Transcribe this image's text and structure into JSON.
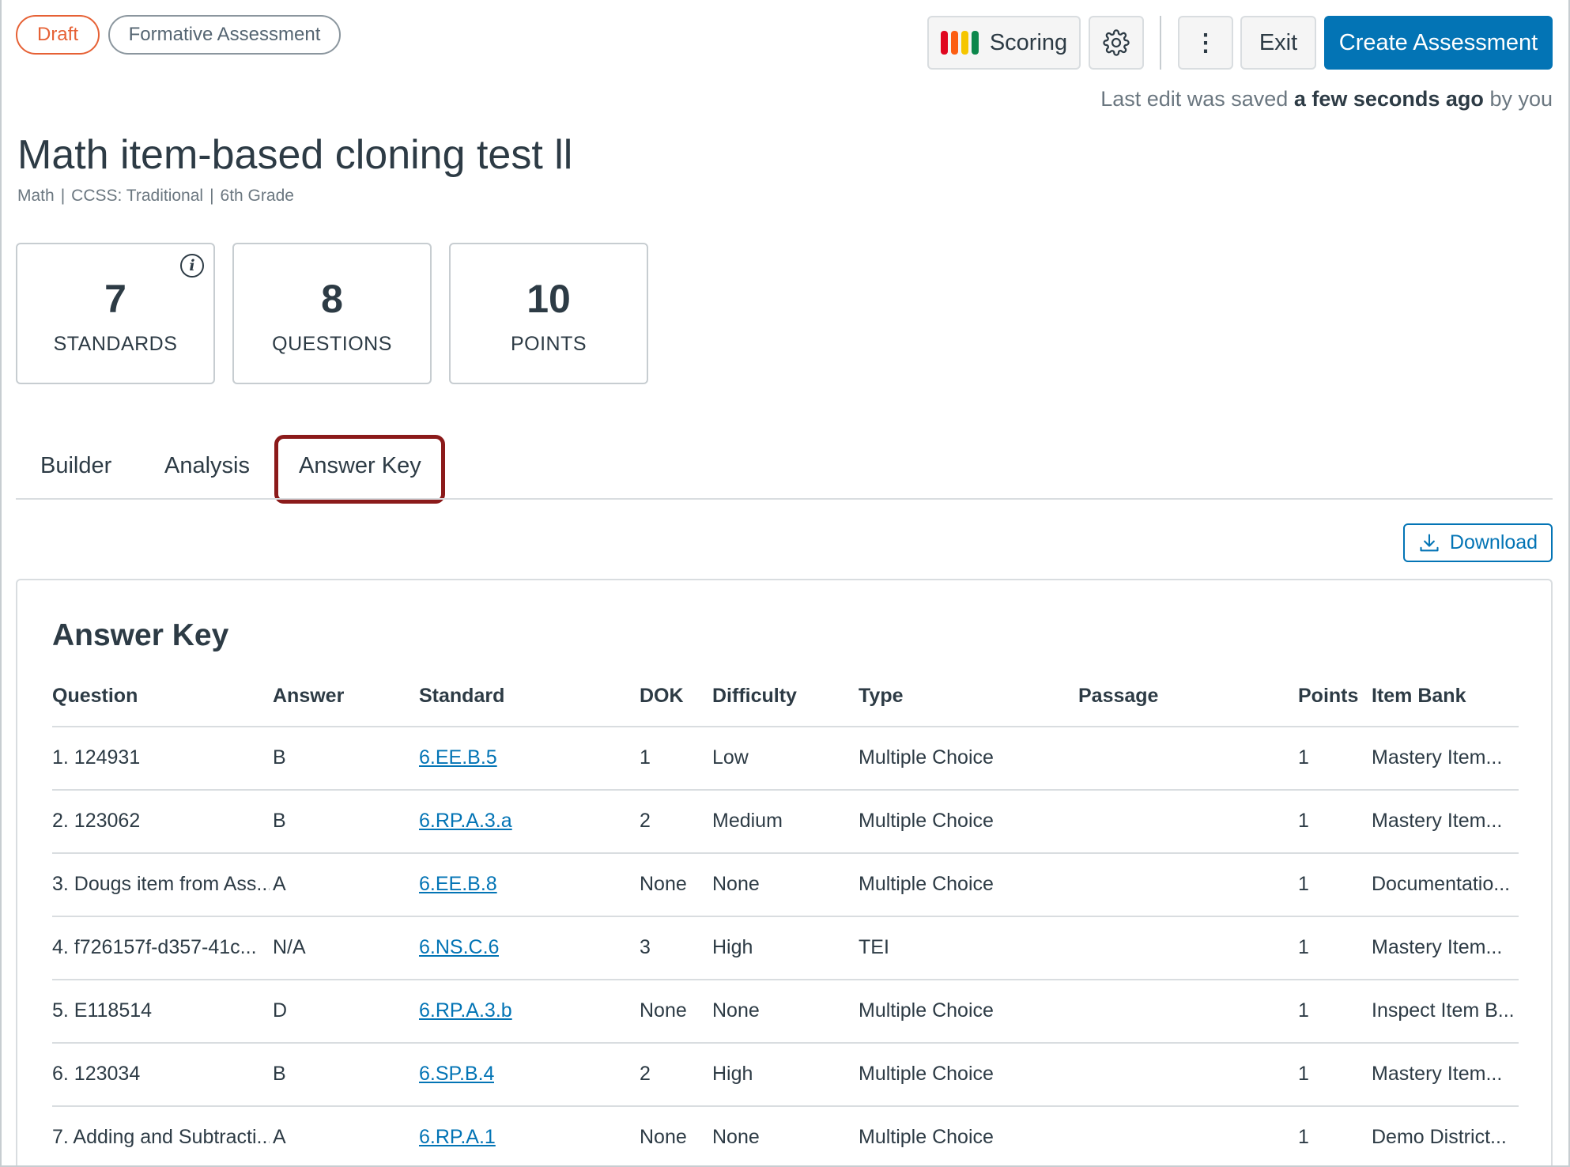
{
  "badges": {
    "status": "Draft",
    "type": "Formative Assessment"
  },
  "toolbar": {
    "scoring_label": "Scoring",
    "scoring_bar_colors": [
      "#e0061f",
      "#fc5e13",
      "#f5c600",
      "#0b874b"
    ],
    "settings_icon": "gear-icon",
    "more_icon": "vertical-ellipsis-icon",
    "more_glyph": "⋮",
    "exit_label": "Exit",
    "create_label": "Create Assessment"
  },
  "last_edit": {
    "prefix": "Last edit was saved",
    "when": "a few seconds ago",
    "suffix": "by you"
  },
  "assessment": {
    "title": "Math item-based cloning test ll",
    "meta": [
      "Math",
      "CCSS: Traditional",
      "6th Grade"
    ],
    "meta_separator": "|"
  },
  "stats": [
    {
      "value": "7",
      "label": "STANDARDS",
      "info_glyph": "i"
    },
    {
      "value": "8",
      "label": "QUESTIONS"
    },
    {
      "value": "10",
      "label": "POINTS"
    }
  ],
  "tabs": [
    {
      "label": "Builder",
      "active": false
    },
    {
      "label": "Analysis",
      "active": false
    },
    {
      "label": "Answer Key",
      "active": true
    }
  ],
  "download_label": "Download",
  "answer_key": {
    "heading": "Answer Key",
    "columns": [
      "Question",
      "Answer",
      "Standard",
      "DOK",
      "Difficulty",
      "Type",
      "Passage",
      "Points",
      "Item Bank"
    ],
    "rows": [
      {
        "question": "1. 124931",
        "answer": "B",
        "standard": "6.EE.B.5",
        "dok": "1",
        "difficulty": "Low",
        "type": "Multiple Choice",
        "passage": "",
        "points": "1",
        "bank": "Mastery Item..."
      },
      {
        "question": "2. 123062",
        "answer": "B",
        "standard": "6.RP.A.3.a",
        "dok": "2",
        "difficulty": "Medium",
        "type": "Multiple Choice",
        "passage": "",
        "points": "1",
        "bank": "Mastery Item..."
      },
      {
        "question": "3. Dougs item from Ass...",
        "answer": "A",
        "standard": "6.EE.B.8",
        "dok": "None",
        "difficulty": "None",
        "type": "Multiple Choice",
        "passage": "",
        "points": "1",
        "bank": "Documentatio..."
      },
      {
        "question": "4. f726157f-d357-41c...",
        "answer": "N/A",
        "standard": "6.NS.C.6",
        "dok": "3",
        "difficulty": "High",
        "type": "TEI",
        "passage": "",
        "points": "1",
        "bank": "Mastery Item..."
      },
      {
        "question": "5. E118514",
        "answer": "D",
        "standard": "6.RP.A.3.b",
        "dok": "None",
        "difficulty": "None",
        "type": "Multiple Choice",
        "passage": "",
        "points": "1",
        "bank": "Inspect Item B..."
      },
      {
        "question": "6. 123034",
        "answer": "B",
        "standard": "6.SP.B.4",
        "dok": "2",
        "difficulty": "High",
        "type": "Multiple Choice",
        "passage": "",
        "points": "1",
        "bank": "Mastery Item..."
      },
      {
        "question": "7. Adding and Subtracti...",
        "answer": "A",
        "standard": "6.RP.A.1",
        "dok": "None",
        "difficulty": "None",
        "type": "Multiple Choice",
        "passage": "",
        "points": "1",
        "bank": "Demo District..."
      }
    ]
  }
}
